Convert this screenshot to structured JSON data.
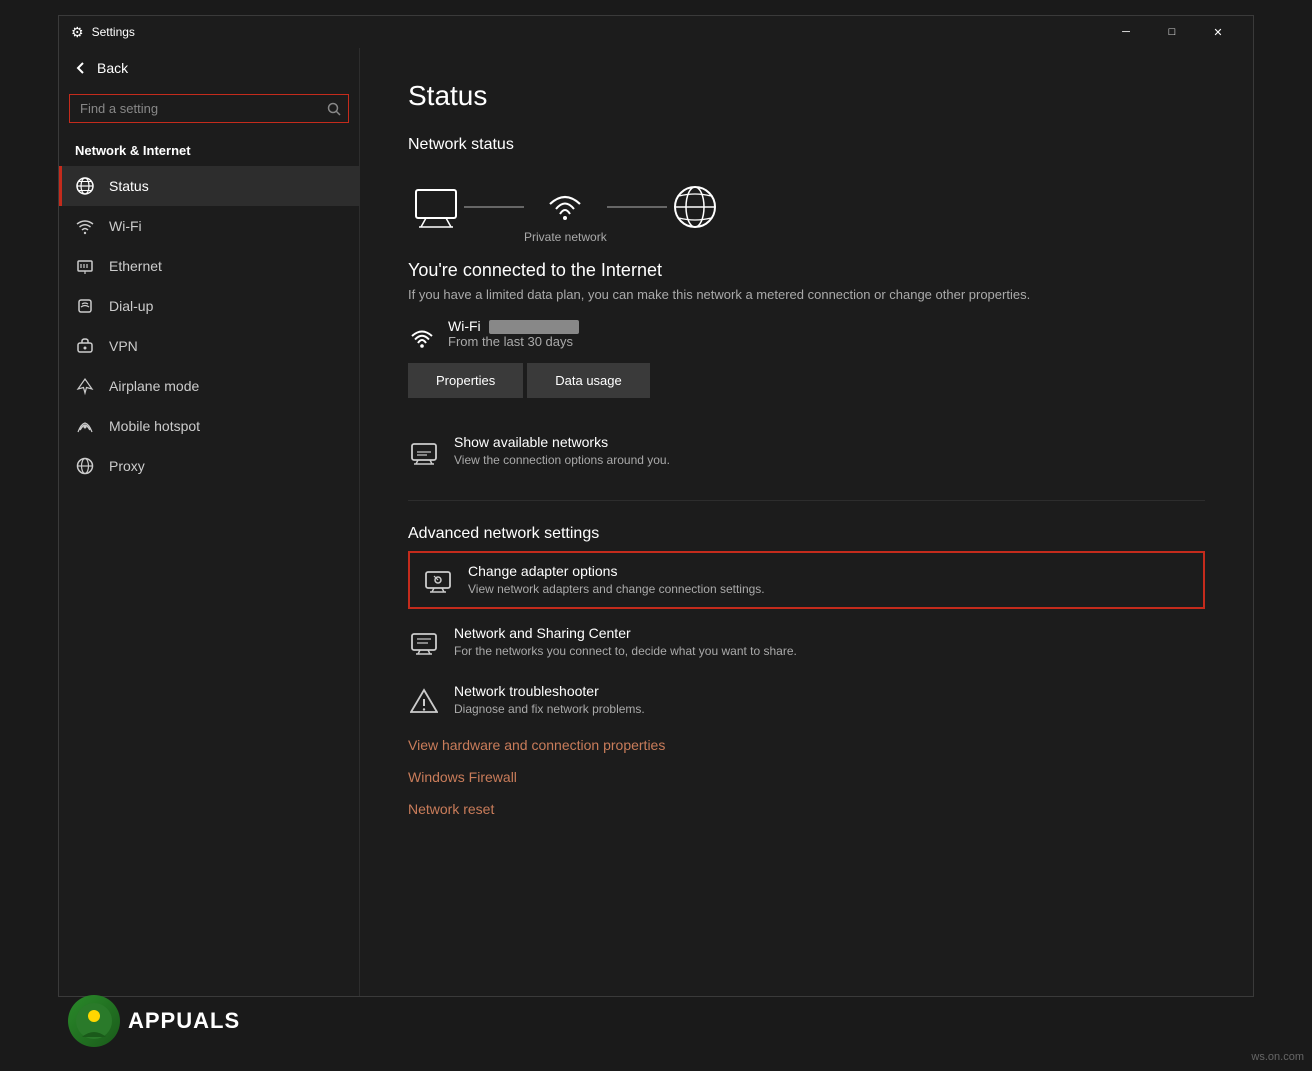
{
  "window": {
    "title": "Settings",
    "titlebar_icon": "⚙",
    "minimize_label": "─",
    "maximize_label": "□",
    "close_label": "✕"
  },
  "sidebar": {
    "back_label": "Back",
    "search_placeholder": "Find a setting",
    "section_title": "Network & Internet",
    "items": [
      {
        "id": "status",
        "label": "Status",
        "icon": "globe"
      },
      {
        "id": "wifi",
        "label": "Wi-Fi",
        "icon": "wifi"
      },
      {
        "id": "ethernet",
        "label": "Ethernet",
        "icon": "ethernet"
      },
      {
        "id": "dialup",
        "label": "Dial-up",
        "icon": "dialup"
      },
      {
        "id": "vpn",
        "label": "VPN",
        "icon": "vpn"
      },
      {
        "id": "airplane",
        "label": "Airplane mode",
        "icon": "airplane"
      },
      {
        "id": "hotspot",
        "label": "Mobile hotspot",
        "icon": "hotspot"
      },
      {
        "id": "proxy",
        "label": "Proxy",
        "icon": "proxy"
      }
    ]
  },
  "main": {
    "page_title": "Status",
    "network_status_title": "Network status",
    "network_label": "Private network",
    "connected_title": "You're connected to the Internet",
    "connected_sub": "If you have a limited data plan, you can make this network a metered connection or change other properties.",
    "wifi_name": "Wi-Fi",
    "wifi_days": "From the last 30 days",
    "properties_btn": "Properties",
    "data_usage_btn": "Data usage",
    "show_networks_title": "Show available networks",
    "show_networks_sub": "View the connection options around you.",
    "advanced_title": "Advanced network settings",
    "items": [
      {
        "id": "change-adapter",
        "title": "Change adapter options",
        "sub": "View network adapters and change connection settings.",
        "highlighted": true
      },
      {
        "id": "sharing-center",
        "title": "Network and Sharing Center",
        "sub": "For the networks you connect to, decide what you want to share.",
        "highlighted": false
      },
      {
        "id": "troubleshooter",
        "title": "Network troubleshooter",
        "sub": "Diagnose and fix network problems.",
        "highlighted": false
      }
    ],
    "links": [
      "View hardware and connection properties",
      "Windows Firewall",
      "Network reset"
    ]
  },
  "watermark": "ws.on.com"
}
